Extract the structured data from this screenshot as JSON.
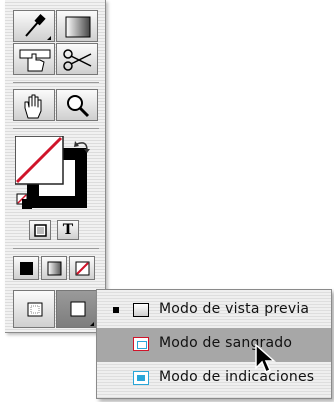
{
  "toolbox": {
    "tools": [
      {
        "name": "eyedropper-icon"
      },
      {
        "name": "gradient-icon"
      },
      {
        "name": "hand-icon"
      },
      {
        "name": "scissors-icon"
      },
      {
        "name": "hand-icon"
      },
      {
        "name": "zoom-icon"
      }
    ],
    "fill_stroke": {
      "fill": "none",
      "stroke": "#000000"
    },
    "text_tool_label": "T"
  },
  "flyout_menu": {
    "items": [
      {
        "label": "Modo de vista previa",
        "checked": true,
        "highlighted": false,
        "icon": "preview-mode-icon"
      },
      {
        "label": "Modo de sangrado",
        "checked": false,
        "highlighted": true,
        "icon": "bleed-mode-icon"
      },
      {
        "label": "Modo de indicaciones",
        "checked": false,
        "highlighted": false,
        "icon": "slug-mode-icon"
      }
    ]
  },
  "colors": {
    "accent_red": "#d0142a",
    "icon_blue": "#2aa6d8",
    "highlight": "#a7a7a7"
  }
}
